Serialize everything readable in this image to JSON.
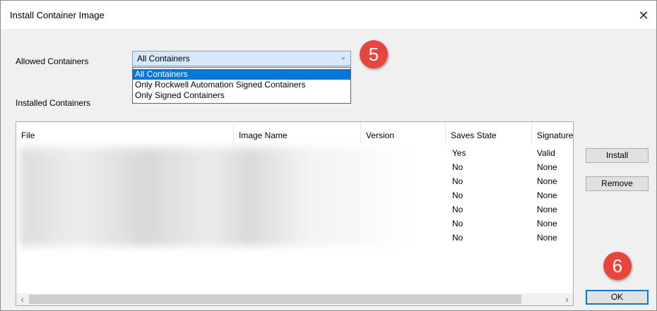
{
  "window": {
    "title": "Install Container Image",
    "close_glyph": "✕"
  },
  "allowed": {
    "label": "Allowed Containers",
    "selected": "All Containers",
    "options": [
      "All Containers",
      "Only Rockwell Automation Signed Containers",
      "Only Signed Containers"
    ]
  },
  "installed": {
    "label": "Installed Containers",
    "columns": [
      "File",
      "Image Name",
      "Version",
      "Saves State",
      "Signature"
    ],
    "rows": [
      {
        "saves_state": "Yes",
        "signature": "Valid"
      },
      {
        "saves_state": "No",
        "signature": "None"
      },
      {
        "saves_state": "No",
        "signature": "None"
      },
      {
        "saves_state": "No",
        "signature": "None"
      },
      {
        "saves_state": "No",
        "signature": "None"
      },
      {
        "saves_state": "No",
        "signature": "None"
      },
      {
        "saves_state": "No",
        "signature": "None"
      }
    ]
  },
  "buttons": {
    "install": "Install",
    "remove": "Remove",
    "ok": "OK"
  },
  "annotations": {
    "step_a": "5",
    "step_b": "6",
    "color": "#e8453c"
  },
  "icons": {
    "chevron": "chevron-down-icon",
    "scroll_left": "‹",
    "scroll_right": "›"
  }
}
